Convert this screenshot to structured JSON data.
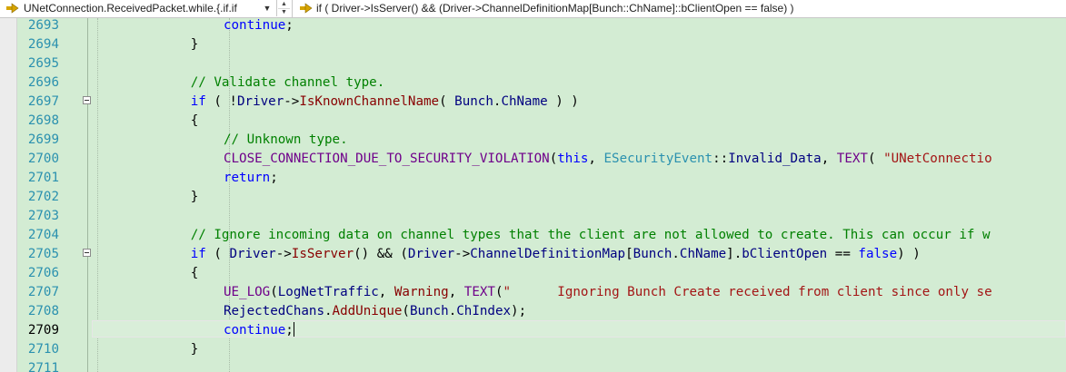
{
  "navbar": {
    "scope": "UNetConnection.ReceivedPacket.while.{.if.if",
    "member": "if ( Driver->IsServer() && (Driver->ChannelDefinitionMap[Bunch::ChName]::bClientOpen == false) )",
    "scope_icon": "arrow-nav-icon",
    "member_icon": "arrow-nav-icon"
  },
  "editor": {
    "current_line": 2709,
    "lines": [
      {
        "num": "2693",
        "tokens": [
          {
            "t": "continue",
            "c": "kw"
          },
          {
            "t": ";",
            "c": "op"
          }
        ]
      },
      {
        "num": "2694",
        "tokens": [
          {
            "t": "}",
            "c": "op"
          }
        ]
      },
      {
        "num": "2695",
        "tokens": []
      },
      {
        "num": "2696",
        "tokens": [
          {
            "t": "// Validate channel type.",
            "c": "cm"
          }
        ]
      },
      {
        "num": "2697",
        "tokens": [
          {
            "t": "if",
            "c": "kw"
          },
          {
            "t": " ( !",
            "c": "op"
          },
          {
            "t": "Driver",
            "c": "id"
          },
          {
            "t": "->",
            "c": "op"
          },
          {
            "t": "IsKnownChannelName",
            "c": "fn"
          },
          {
            "t": "( ",
            "c": "op"
          },
          {
            "t": "Bunch",
            "c": "id"
          },
          {
            "t": ".",
            "c": "op"
          },
          {
            "t": "ChName",
            "c": "id"
          },
          {
            "t": " ) )",
            "c": "op"
          }
        ]
      },
      {
        "num": "2698",
        "tokens": [
          {
            "t": "{",
            "c": "op"
          }
        ]
      },
      {
        "num": "2699",
        "tokens": [
          {
            "t": "// Unknown type.",
            "c": "cm"
          }
        ]
      },
      {
        "num": "2700",
        "tokens": [
          {
            "t": "CLOSE_CONNECTION_DUE_TO_SECURITY_VIOLATION",
            "c": "mc"
          },
          {
            "t": "(",
            "c": "op"
          },
          {
            "t": "this",
            "c": "kw"
          },
          {
            "t": ", ",
            "c": "op"
          },
          {
            "t": "ESecurityEvent",
            "c": "ty"
          },
          {
            "t": "::",
            "c": "op"
          },
          {
            "t": "Invalid_Data",
            "c": "id"
          },
          {
            "t": ", ",
            "c": "op"
          },
          {
            "t": "TEXT",
            "c": "mc"
          },
          {
            "t": "( ",
            "c": "op"
          },
          {
            "t": "\"UNetConnectio",
            "c": "st"
          }
        ]
      },
      {
        "num": "2701",
        "tokens": [
          {
            "t": "return",
            "c": "kw"
          },
          {
            "t": ";",
            "c": "op"
          }
        ]
      },
      {
        "num": "2702",
        "tokens": [
          {
            "t": "}",
            "c": "op"
          }
        ]
      },
      {
        "num": "2703",
        "tokens": []
      },
      {
        "num": "2704",
        "tokens": [
          {
            "t": "// Ignore incoming data on channel types that the client are not allowed to create. This can occur if w",
            "c": "cm"
          }
        ]
      },
      {
        "num": "2705",
        "tokens": [
          {
            "t": "if",
            "c": "kw"
          },
          {
            "t": " ( ",
            "c": "op"
          },
          {
            "t": "Driver",
            "c": "id"
          },
          {
            "t": "->",
            "c": "op"
          },
          {
            "t": "IsServer",
            "c": "fn"
          },
          {
            "t": "() && (",
            "c": "op"
          },
          {
            "t": "Driver",
            "c": "id"
          },
          {
            "t": "->",
            "c": "op"
          },
          {
            "t": "ChannelDefinitionMap",
            "c": "id"
          },
          {
            "t": "[",
            "c": "op"
          },
          {
            "t": "Bunch",
            "c": "id"
          },
          {
            "t": ".",
            "c": "op"
          },
          {
            "t": "ChName",
            "c": "id"
          },
          {
            "t": "].",
            "c": "op"
          },
          {
            "t": "bClientOpen",
            "c": "id"
          },
          {
            "t": " == ",
            "c": "op"
          },
          {
            "t": "false",
            "c": "kw"
          },
          {
            "t": ") )",
            "c": "op"
          }
        ]
      },
      {
        "num": "2706",
        "tokens": [
          {
            "t": "{",
            "c": "op"
          }
        ]
      },
      {
        "num": "2707",
        "tokens": [
          {
            "t": "UE_LOG",
            "c": "mc"
          },
          {
            "t": "(",
            "c": "op"
          },
          {
            "t": "LogNetTraffic",
            "c": "id"
          },
          {
            "t": ", ",
            "c": "op"
          },
          {
            "t": "Warning",
            "c": "fn"
          },
          {
            "t": ", ",
            "c": "op"
          },
          {
            "t": "TEXT",
            "c": "mc"
          },
          {
            "t": "(",
            "c": "op"
          },
          {
            "t": "\"      Ignoring Bunch Create received from client since only se",
            "c": "st"
          }
        ]
      },
      {
        "num": "2708",
        "tokens": [
          {
            "t": "RejectedChans",
            "c": "id"
          },
          {
            "t": ".",
            "c": "op"
          },
          {
            "t": "AddUnique",
            "c": "fn"
          },
          {
            "t": "(",
            "c": "op"
          },
          {
            "t": "Bunch",
            "c": "id"
          },
          {
            "t": ".",
            "c": "op"
          },
          {
            "t": "ChIndex",
            "c": "id"
          },
          {
            "t": ");",
            "c": "op"
          }
        ]
      },
      {
        "num": "2709",
        "tokens": [
          {
            "t": "continue",
            "c": "kw"
          },
          {
            "t": ";",
            "c": "op"
          }
        ]
      },
      {
        "num": "2710",
        "tokens": [
          {
            "t": "}",
            "c": "op"
          }
        ]
      },
      {
        "num": "2711",
        "tokens": []
      }
    ]
  }
}
